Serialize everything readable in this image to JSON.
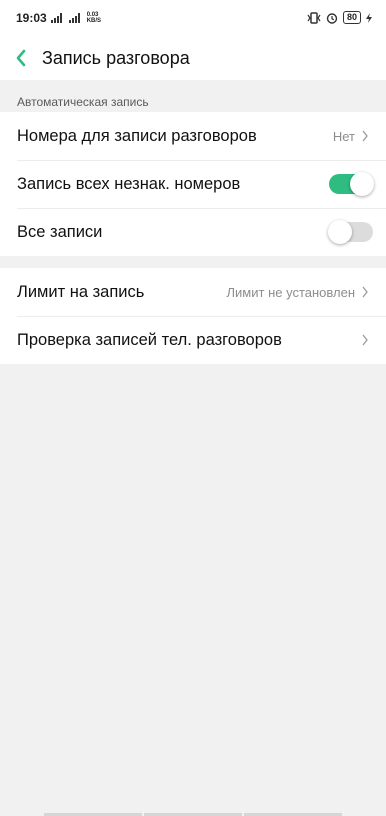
{
  "status_bar": {
    "time": "19:03",
    "net_speed_top": "0.03",
    "net_speed_bottom": "KB/S",
    "battery": "80"
  },
  "header": {
    "title": "Запись разговора"
  },
  "section": {
    "label": "Автоматическая запись"
  },
  "group1": [
    {
      "label": "Номера для записи разговоров",
      "value": "Нет"
    },
    {
      "label": "Запись всех незнак. номеров",
      "toggle": "on"
    },
    {
      "label": "Все записи",
      "toggle": "off"
    }
  ],
  "group2": [
    {
      "label": "Лимит на запись",
      "value": "Лимит не установлен"
    },
    {
      "label": "Проверка записей тел. разговоров"
    }
  ],
  "colors": {
    "accent": "#2fbc81",
    "background": "#f1f1f1"
  }
}
